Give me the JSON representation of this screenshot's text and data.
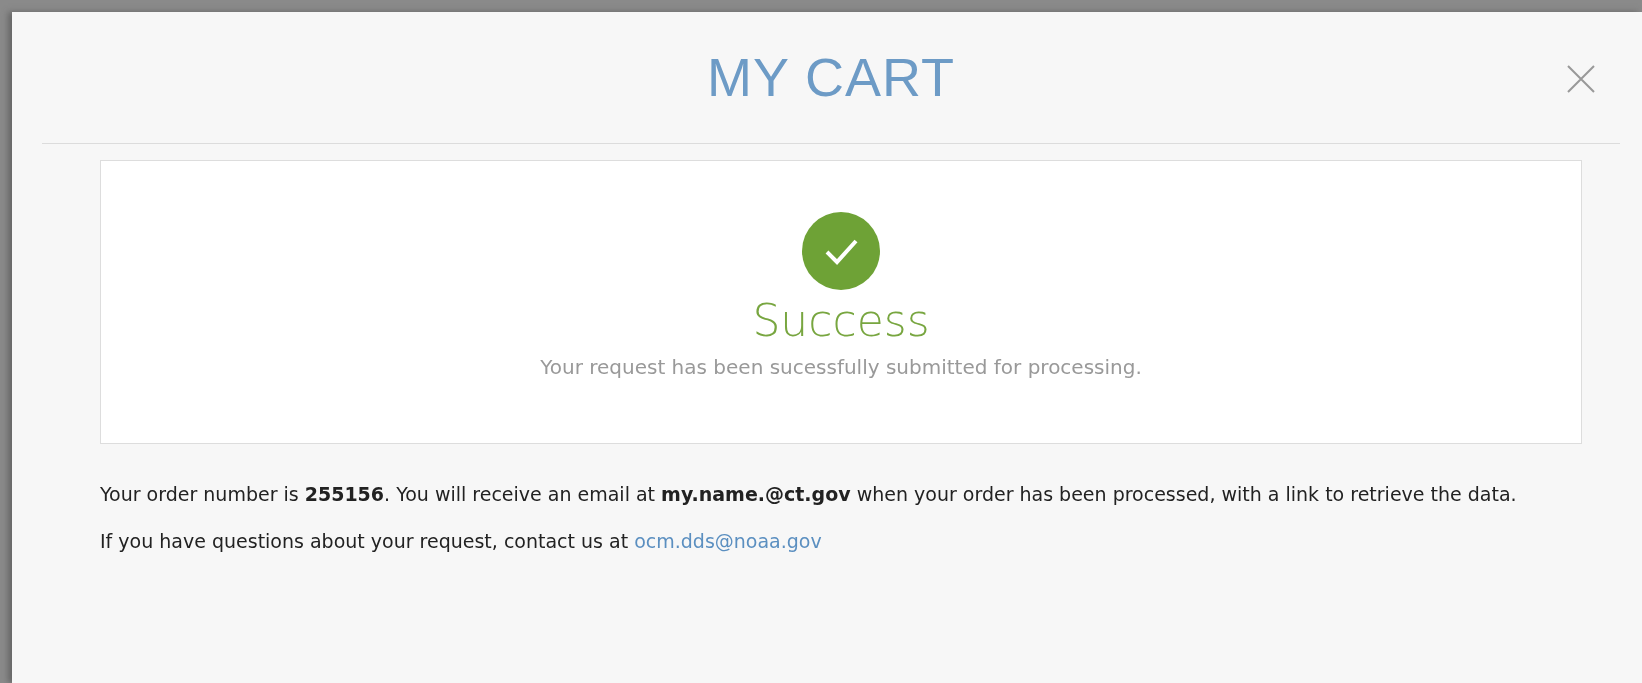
{
  "modal": {
    "title": "MY CART",
    "success": {
      "heading": "Success",
      "message": "Your request has been sucessfully submitted for processing."
    },
    "order_text": "Your order number is **255156**. You will receive an email at **my.name.@ct.gov** when your order has been processed, with a link to retrieve the data.",
    "contact": {
      "text": "If you have questions about your request, contact us at",
      "email": "ocm.dds@noaa.gov"
    }
  }
}
